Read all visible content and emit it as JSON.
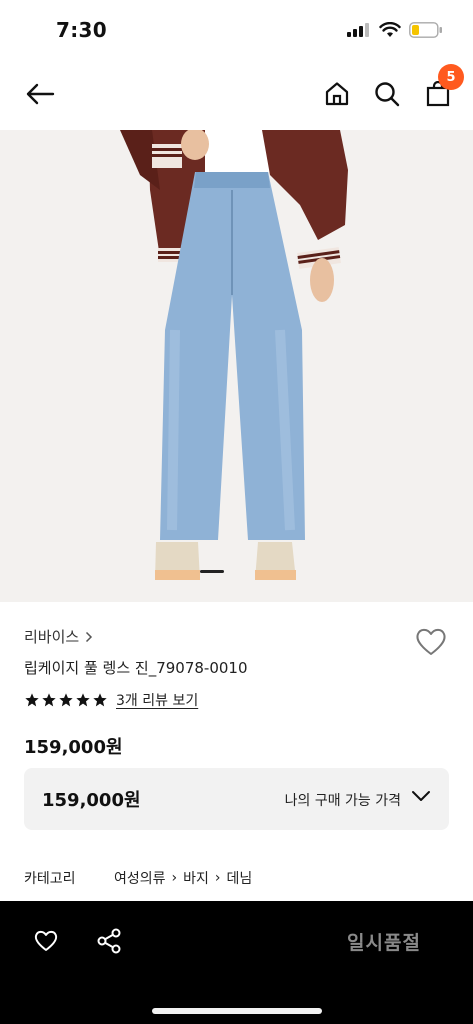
{
  "status_bar": {
    "time": "7:30"
  },
  "nav": {
    "cart_count": "5"
  },
  "product": {
    "brand": "리바이스",
    "name": "립케이지 풀 렝스 진_79078-0010",
    "rating_stars": 5,
    "review_link": "3개 리뷰 보기",
    "price": "159,000원",
    "my_price_value": "159,000원",
    "my_price_label": "나의 구매 가능 가격"
  },
  "category": {
    "label": "카테고리",
    "crumbs": [
      "여성의류",
      "바지",
      "데님"
    ]
  },
  "bottom_bar": {
    "status": "일시품절"
  },
  "colors": {
    "accent": "#ff5a1f",
    "bottom_bar": "#000000",
    "price_box": "#f2f2f2"
  }
}
